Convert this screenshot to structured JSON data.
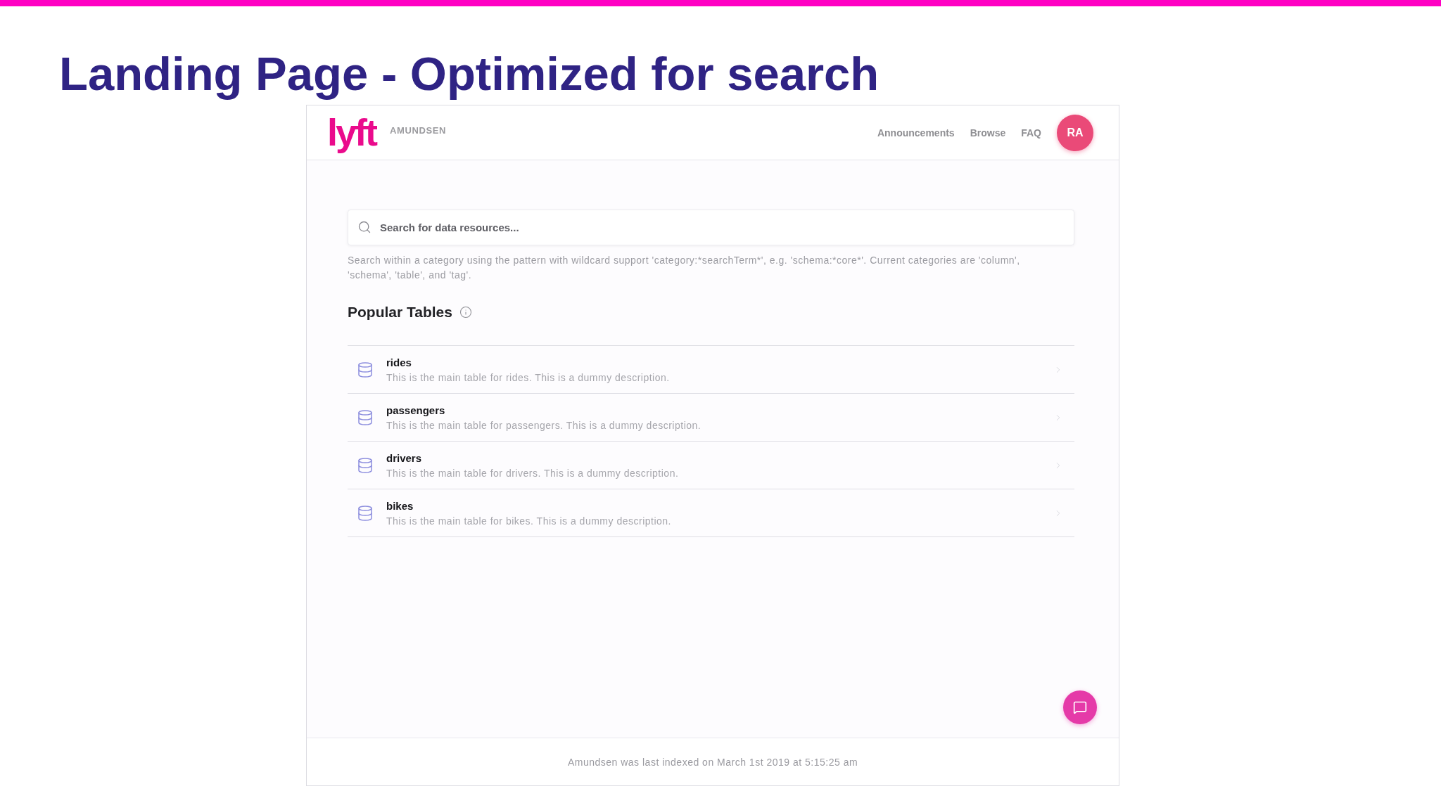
{
  "slide": {
    "title": "Landing Page - Optimized for search"
  },
  "app": {
    "header": {
      "logo": "lyft",
      "product": "AMUNDSEN",
      "nav": [
        "Announcements",
        "Browse",
        "FAQ"
      ],
      "avatar": "RA"
    },
    "search": {
      "placeholder": "Search for data resources...",
      "hint": "Search within a category using the pattern with wildcard support 'category:*searchTerm*', e.g. 'schema:*core*'. Current categories are 'column', 'schema', 'table', and 'tag'."
    },
    "popular_tables": {
      "title": "Popular Tables",
      "rows": [
        {
          "name": "rides",
          "description": "This is the main table for rides. This is a dummy description."
        },
        {
          "name": "passengers",
          "description": "This is the main table for passengers. This is a dummy description."
        },
        {
          "name": "drivers",
          "description": "This is the main table for drivers. This is a dummy description."
        },
        {
          "name": "bikes",
          "description": "This is the main table for bikes. This is a dummy description."
        }
      ]
    },
    "footer": "Amundsen was last indexed on March 1st 2019 at 5:15:25 am"
  }
}
